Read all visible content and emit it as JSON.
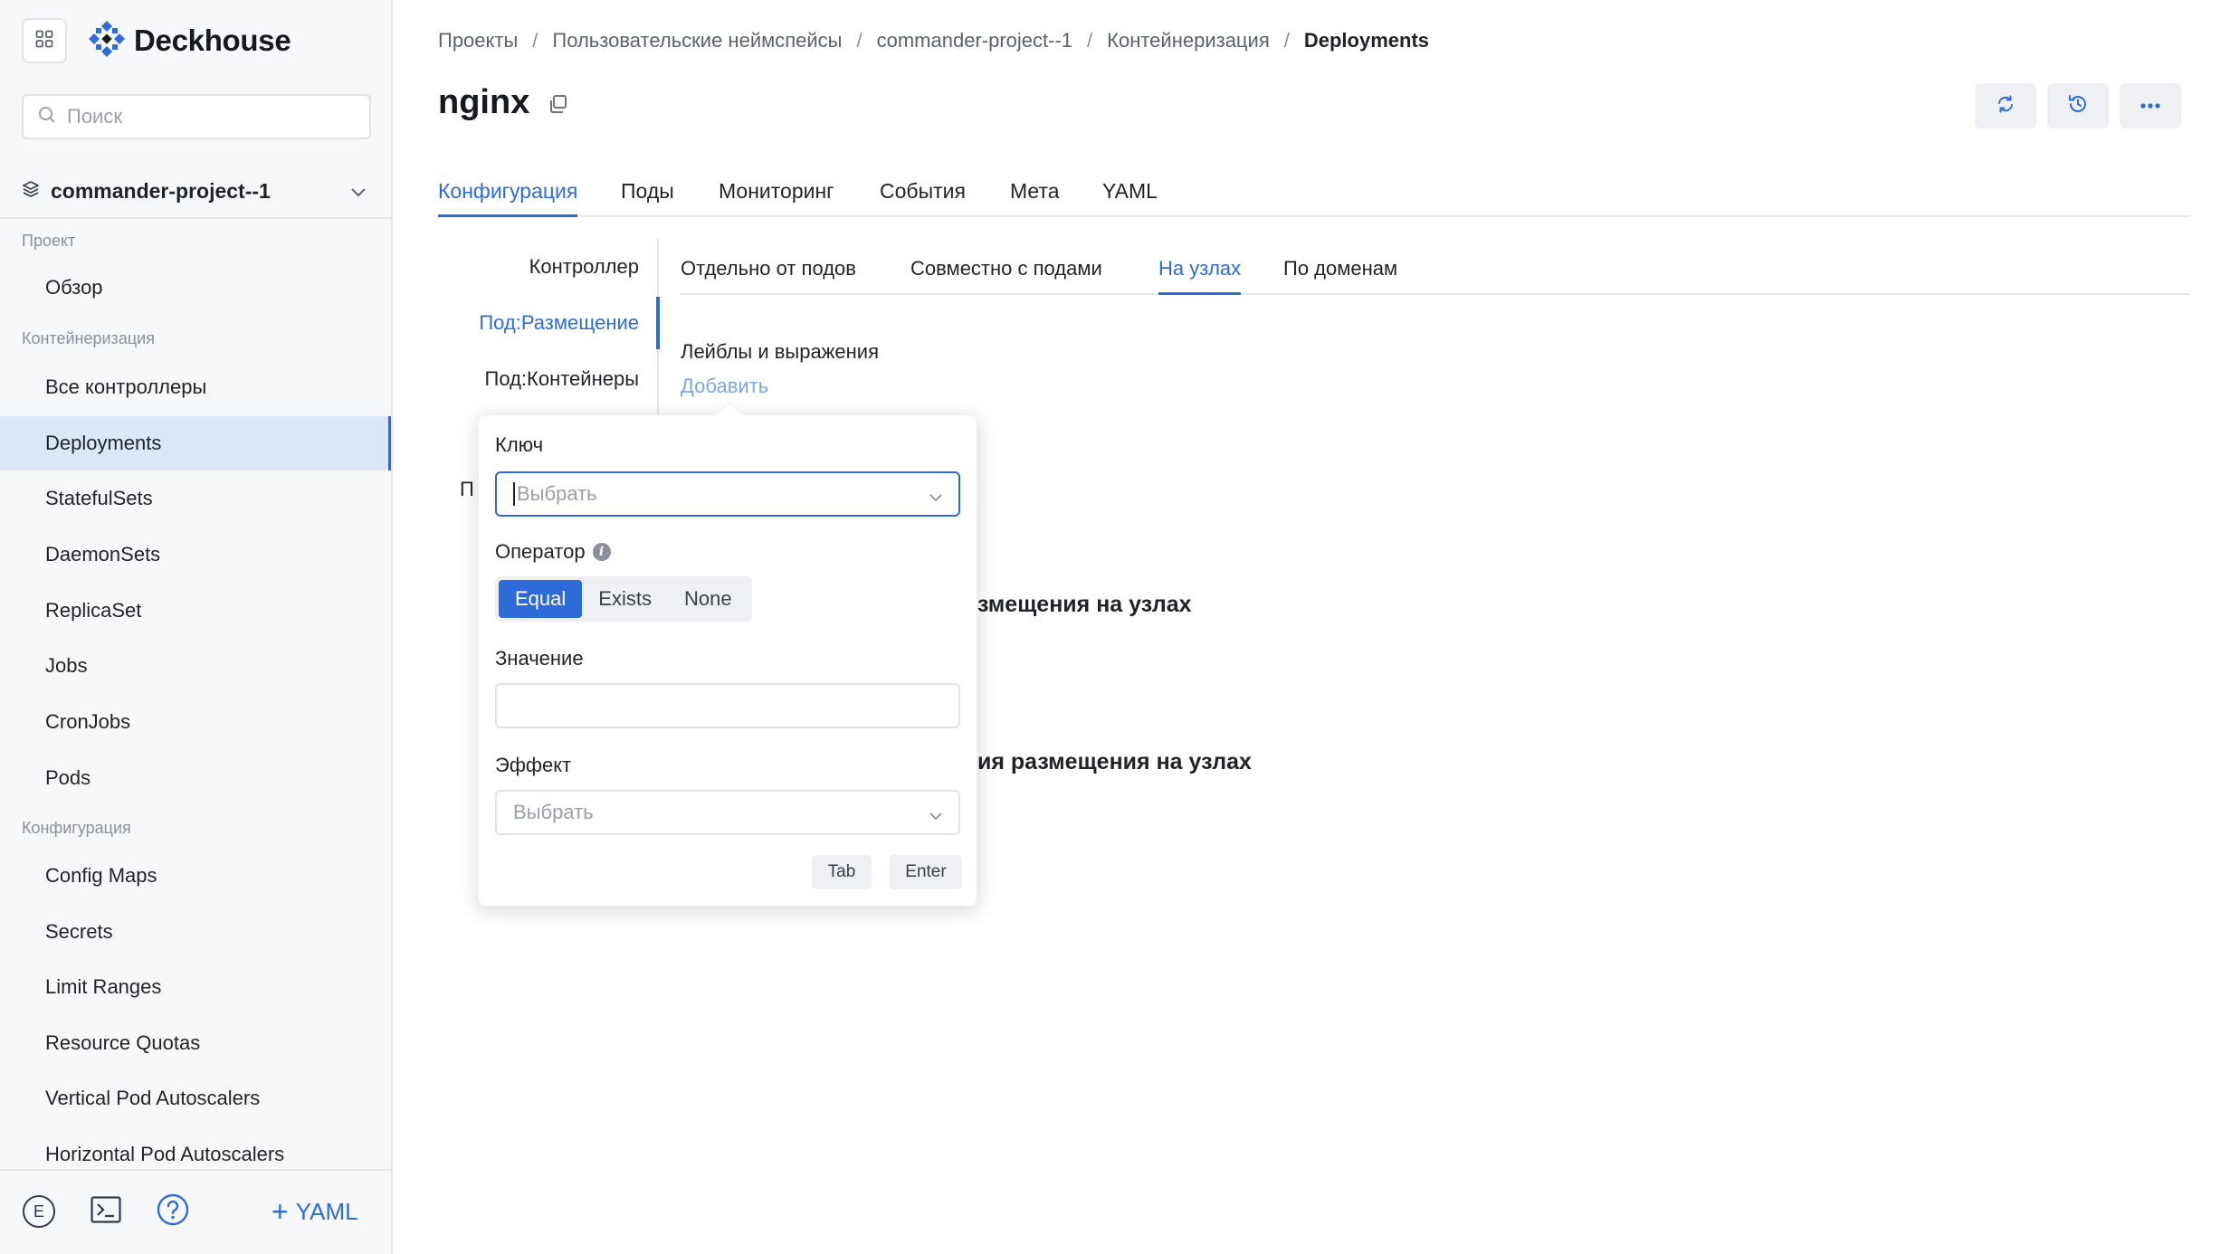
{
  "app": {
    "brand": "Deckhouse",
    "accent_color": "#2d6bd9"
  },
  "sidebar": {
    "search_placeholder": "Поиск",
    "project": "commander-project--1",
    "sections": [
      {
        "label": "Проект",
        "items": [
          "Обзор"
        ]
      },
      {
        "label": "Контейнеризация",
        "items": [
          "Все контроллеры",
          "Deployments",
          "StatefulSets",
          "DaemonSets",
          "ReplicaSet",
          "Jobs",
          "CronJobs",
          "Pods"
        ]
      },
      {
        "label": "Конфигурация",
        "items": [
          "Config Maps",
          "Secrets",
          "Limit Ranges",
          "Resource Quotas",
          "Vertical Pod Autoscalers",
          "Horizontal Pod Autoscalers"
        ]
      }
    ],
    "active_item": "Deployments",
    "footer": {
      "avatar_letter": "E",
      "yaml_label": "YAML"
    }
  },
  "breadcrumb": [
    "Проекты",
    "Пользовательские неймспейсы",
    "commander-project--1",
    "Контейнеризация",
    "Deployments"
  ],
  "page": {
    "title": "nginx"
  },
  "tabs": [
    "Конфигурация",
    "Поды",
    "Мониторинг",
    "События",
    "Мета",
    "YAML"
  ],
  "active_tab": "Конфигурация",
  "side_tabs": [
    "Контроллер",
    "Под:Размещение",
    "Под:Контейнеры"
  ],
  "active_side_tab": "Под:Размещение",
  "subtabs": [
    "Отдельно от подов",
    "Совместно с подами",
    "На узлах",
    "По доменам"
  ],
  "active_subtab": "На узлах",
  "content": {
    "labels_heading": "Лейблы и выражения",
    "add_link": "Добавить",
    "partial_left": "П",
    "heading_1_fragment": "змещения на узлах",
    "heading_2_fragment": "ия размещения на узлах"
  },
  "popover": {
    "key_label": "Ключ",
    "key_placeholder": "Выбрать",
    "operator_label": "Оператор",
    "operators": [
      "Equal",
      "Exists",
      "None"
    ],
    "active_operator": "Equal",
    "value_label": "Значение",
    "value": "",
    "effect_label": "Эффект",
    "effect_placeholder": "Выбрать",
    "keys": [
      "Tab",
      "Enter"
    ]
  }
}
